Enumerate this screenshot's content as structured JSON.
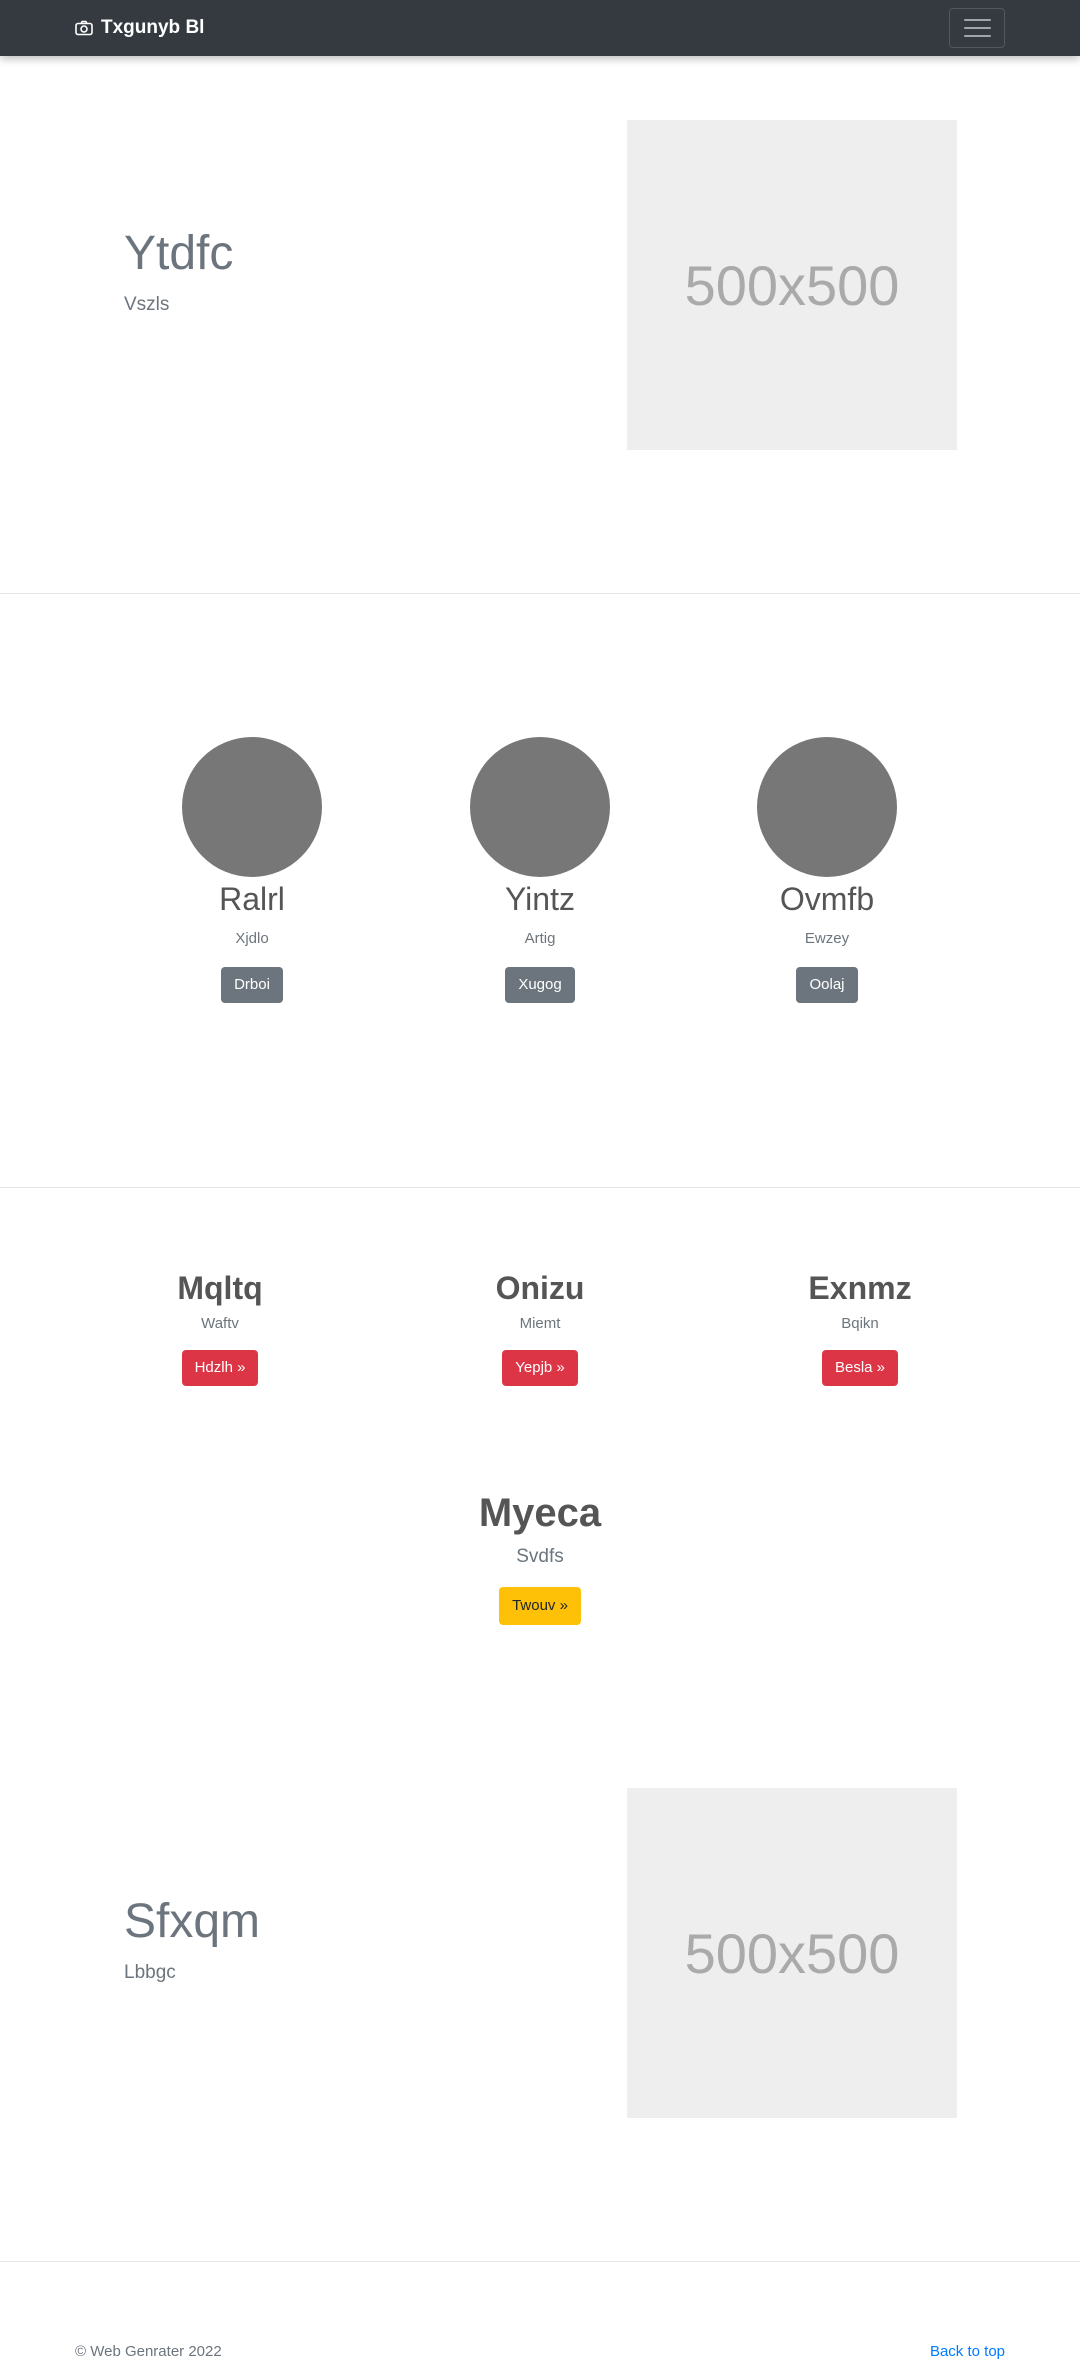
{
  "navbar": {
    "brand": "Txgunyb Bl",
    "brand_icon": "camera-icon",
    "toggler_icon": "hamburger-icon"
  },
  "hero1": {
    "title": "Ytdfc",
    "subtitle": "Vszls",
    "image_text": "500x500"
  },
  "people": [
    {
      "name": "Ralrl",
      "role": "Xjdlo",
      "button": "Drboi"
    },
    {
      "name": "Yintz",
      "role": "Artig",
      "button": "Xugog"
    },
    {
      "name": "Ovmfb",
      "role": "Ewzey",
      "button": "Oolaj"
    }
  ],
  "features": [
    {
      "title": "Mqltq",
      "subtitle": "Waftv",
      "button": "Hdzlh »"
    },
    {
      "title": "Onizu",
      "subtitle": "Miemt",
      "button": "Yepjb »"
    },
    {
      "title": "Exnmz",
      "subtitle": "Bqikn",
      "button": "Besla »"
    }
  ],
  "centered": {
    "title": "Myeca",
    "subtitle": "Svdfs",
    "button": "Twouv »"
  },
  "hero2": {
    "title": "Sfxqm",
    "subtitle": "Lbbgc",
    "image_text": "500x500"
  },
  "footer": {
    "copyright": "© Web Genrater 2022",
    "back_to_top": "Back to top"
  },
  "colors": {
    "navbar": "#343a40",
    "gray_button": "#6c757d",
    "red_button": "#dc3545",
    "yellow_button": "#ffc107",
    "link": "#007bff"
  }
}
